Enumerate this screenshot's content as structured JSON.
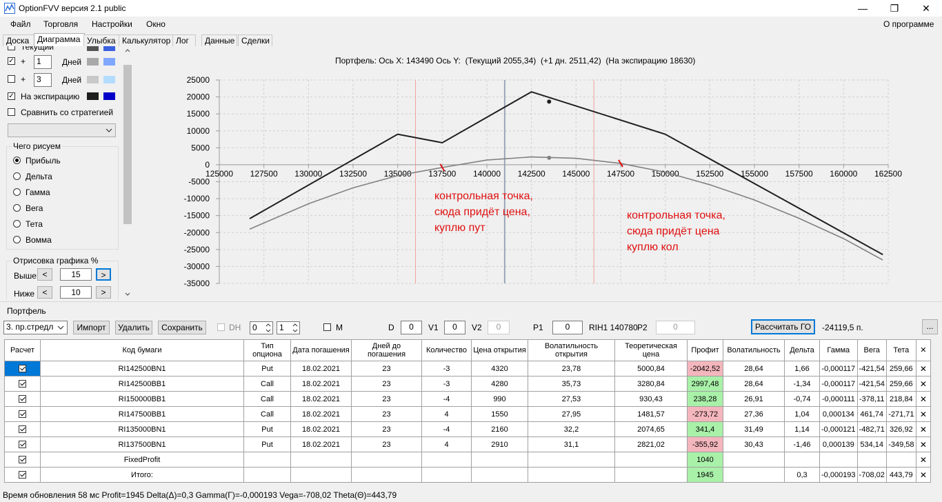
{
  "window": {
    "title": "OptionFVV версия 2.1 public",
    "minimize": "—",
    "maximize": "❐",
    "close": "✕"
  },
  "menu": {
    "items": [
      "Файл",
      "Торговля",
      "Настройки",
      "Окно"
    ],
    "about": "О программе"
  },
  "tabs": [
    "Доска",
    "Диаграмма",
    "Улыбка",
    "Калькулятор",
    "Лог",
    "Данные",
    "Сделки"
  ],
  "left_panel": {
    "partial_label": "Текущий",
    "row1": {
      "checked": true,
      "plus": "+",
      "days_value": "1",
      "days_label": "Дней",
      "colors": [
        "#a9a9a9",
        "#7fa7ff"
      ]
    },
    "row2": {
      "checked": false,
      "plus": "+",
      "days_value": "3",
      "days_label": "Дней",
      "colors": [
        "#c8c8c8",
        "#b3dcff"
      ]
    },
    "expiry": {
      "checked": true,
      "label": "На экспирацию",
      "colors": [
        "#1e1e1e",
        "#0000c8"
      ]
    },
    "compare": {
      "checked": false,
      "label": "Сравнить со стратегией"
    },
    "compare_select_value": "",
    "draw_group": {
      "title": "Чего рисуем",
      "options": [
        "Прибыль",
        "Дельта",
        "Гамма",
        "Вега",
        "Тета",
        "Вомма"
      ],
      "selected": "Прибыль"
    },
    "range_group": {
      "title": "Отрисовка графика %",
      "above_label": "Выше",
      "above_value": "15",
      "below_label": "Ниже",
      "below_value": "10",
      "prev": "<",
      "next": ">"
    }
  },
  "chart": {
    "header": {
      "portfolio_label": "Портфель:",
      "x_label": "Ось X:",
      "x_value": "143490",
      "y_label": "Ось Y:",
      "current": "(Текущий 2055,34)",
      "plus1": "(+1 дн. 2511,42)",
      "expiry": "(На экспирацию 18630)"
    },
    "annotations": [
      {
        "lines": [
          "контрольная точка,",
          "сюда придёт цена,",
          "куплю пут"
        ]
      },
      {
        "lines": [
          "контрольная точка,",
          "сюда придёт цена",
          "куплю кол"
        ]
      }
    ],
    "annotation_color": "#e01010"
  },
  "chart_data": {
    "type": "line",
    "xlim": [
      125000,
      162500
    ],
    "ylim": [
      -35000,
      25000
    ],
    "x_ticks": [
      "125000",
      "127500",
      "130000",
      "132500",
      "135000",
      "137500",
      "140000",
      "142500",
      "145000",
      "147500",
      "150000",
      "152500",
      "155000",
      "157500",
      "160000",
      "162500"
    ],
    "y_ticks": [
      "25000",
      "20000",
      "15000",
      "10000",
      "5000",
      "0",
      "-5000",
      "-10000",
      "-15000",
      "-20000",
      "-25000",
      "-30000",
      "-35000"
    ],
    "grid": true,
    "cursor_x": 141000,
    "red_lines_x": [
      136000,
      146000
    ],
    "series": [
      {
        "color": "#1e1e1e",
        "x": [
          126700,
          135000,
          137500,
          142500,
          150000,
          162200
        ],
        "y": [
          -15900,
          9000,
          6500,
          21500,
          9000,
          -26500
        ],
        "marker": {
          "x": 143490,
          "y": 18630
        }
      },
      {
        "color": "#808080",
        "x": [
          126700,
          130000,
          132500,
          135000,
          137500,
          140000,
          142500,
          145000,
          147500,
          150000,
          152500,
          155000,
          157500,
          160000,
          162200
        ],
        "y": [
          -19000,
          -11500,
          -6800,
          -3200,
          -800,
          1400,
          2300,
          1900,
          400,
          -2200,
          -5900,
          -10400,
          -15800,
          -21800,
          -28100
        ],
        "marker": {
          "x": 143490,
          "y": 2055
        }
      }
    ]
  },
  "portfolio": {
    "title": "Портфель",
    "select_value": "3. пр.стредл",
    "import": "Импорт",
    "delete": "Удалить",
    "save": "Сохранить",
    "dh_label": "DH",
    "spin1": "0",
    "spin2": "1",
    "m_label": "M",
    "d_label": "D",
    "d_value": "0",
    "v1_label": "V1",
    "v1_value": "0",
    "v2_label": "V2",
    "v2_value": "0",
    "p1_label": "P1",
    "p1_value": "0",
    "rih_label": "RIH1 140780",
    "p2_label": "P2",
    "p2_value": "0",
    "calc_button": "Рассчитать ГО",
    "go_value": "-24119,5 п.",
    "more_button": "..."
  },
  "table": {
    "headers": [
      "Расчет",
      "Код бумаги",
      "Тип опциона",
      "Дата погашения",
      "Дней до погашения",
      "Количество",
      "Цена открытия",
      "Волатильность открытия",
      "Теоретическая цена",
      "Профит",
      "Волатильность",
      "Дельта",
      "Гамма",
      "Вега",
      "Тета",
      "✕"
    ],
    "rows": [
      {
        "code": "RI142500BN1",
        "type": "Put",
        "date": "18.02.2021",
        "days": "23",
        "qty": "-3",
        "open": "4320",
        "ovol": "23,78",
        "theo": "5000,84",
        "profit": "-2042,52",
        "profit_color": "#f4b6bd",
        "vol": "28,64",
        "delta": "1,66",
        "gamma": "-0,000117",
        "vega": "-421,54",
        "theta": "259,66",
        "selected": true
      },
      {
        "code": "RI142500BB1",
        "type": "Call",
        "date": "18.02.2021",
        "days": "23",
        "qty": "-3",
        "open": "4280",
        "ovol": "35,73",
        "theo": "3280,84",
        "profit": "2997,48",
        "profit_color": "#a9f0a9",
        "vol": "28,64",
        "delta": "-1,34",
        "gamma": "-0,000117",
        "vega": "-421,54",
        "theta": "259,66"
      },
      {
        "code": "RI150000BB1",
        "type": "Call",
        "date": "18.02.2021",
        "days": "23",
        "qty": "-4",
        "open": "990",
        "ovol": "27,53",
        "theo": "930,43",
        "profit": "238,28",
        "profit_color": "#a9f0a9",
        "vol": "26,91",
        "delta": "-0,74",
        "gamma": "-0,000111",
        "vega": "-378,11",
        "theta": "218,84"
      },
      {
        "code": "RI147500BB1",
        "type": "Call",
        "date": "18.02.2021",
        "days": "23",
        "qty": "4",
        "open": "1550",
        "ovol": "27,95",
        "theo": "1481,57",
        "profit": "-273,72",
        "profit_color": "#f4b6bd",
        "vol": "27,36",
        "delta": "1,04",
        "gamma": "0,000134",
        "vega": "461,74",
        "theta": "-271,71"
      },
      {
        "code": "RI135000BN1",
        "type": "Put",
        "date": "18.02.2021",
        "days": "23",
        "qty": "-4",
        "open": "2160",
        "ovol": "32,2",
        "theo": "2074,65",
        "profit": "341,4",
        "profit_color": "#a9f0a9",
        "vol": "31,49",
        "delta": "1,14",
        "gamma": "-0,000121",
        "vega": "-482,71",
        "theta": "326,92"
      },
      {
        "code": "RI137500BN1",
        "type": "Put",
        "date": "18.02.2021",
        "days": "23",
        "qty": "4",
        "open": "2910",
        "ovol": "31,1",
        "theo": "2821,02",
        "profit": "-355,92",
        "profit_color": "#f4b6bd",
        "vol": "30,43",
        "delta": "-1,46",
        "gamma": "0,000139",
        "vega": "534,14",
        "theta": "-349,58"
      },
      {
        "code": "FixedProfit",
        "type": "",
        "date": "",
        "days": "",
        "qty": "",
        "open": "",
        "ovol": "",
        "theo": "",
        "profit": "1040",
        "profit_color": "#a9f0a9",
        "vol": "",
        "delta": "",
        "gamma": "",
        "vega": "",
        "theta": ""
      },
      {
        "code": "Итого:",
        "type": "",
        "date": "",
        "days": "",
        "qty": "",
        "open": "",
        "ovol": "",
        "theo": "",
        "profit": "1945",
        "profit_color": "#a9f0a9",
        "vol": "",
        "delta": "0,3",
        "gamma": "-0,000193",
        "vega": "-708,02",
        "theta": "443,79"
      }
    ]
  },
  "status": "Время обновления 58 мс  Profit=1945 Delta(Δ)=0,3 Gamma(Γ)=-0,000193 Vega=-708,02 Theta(Θ)=443,79"
}
